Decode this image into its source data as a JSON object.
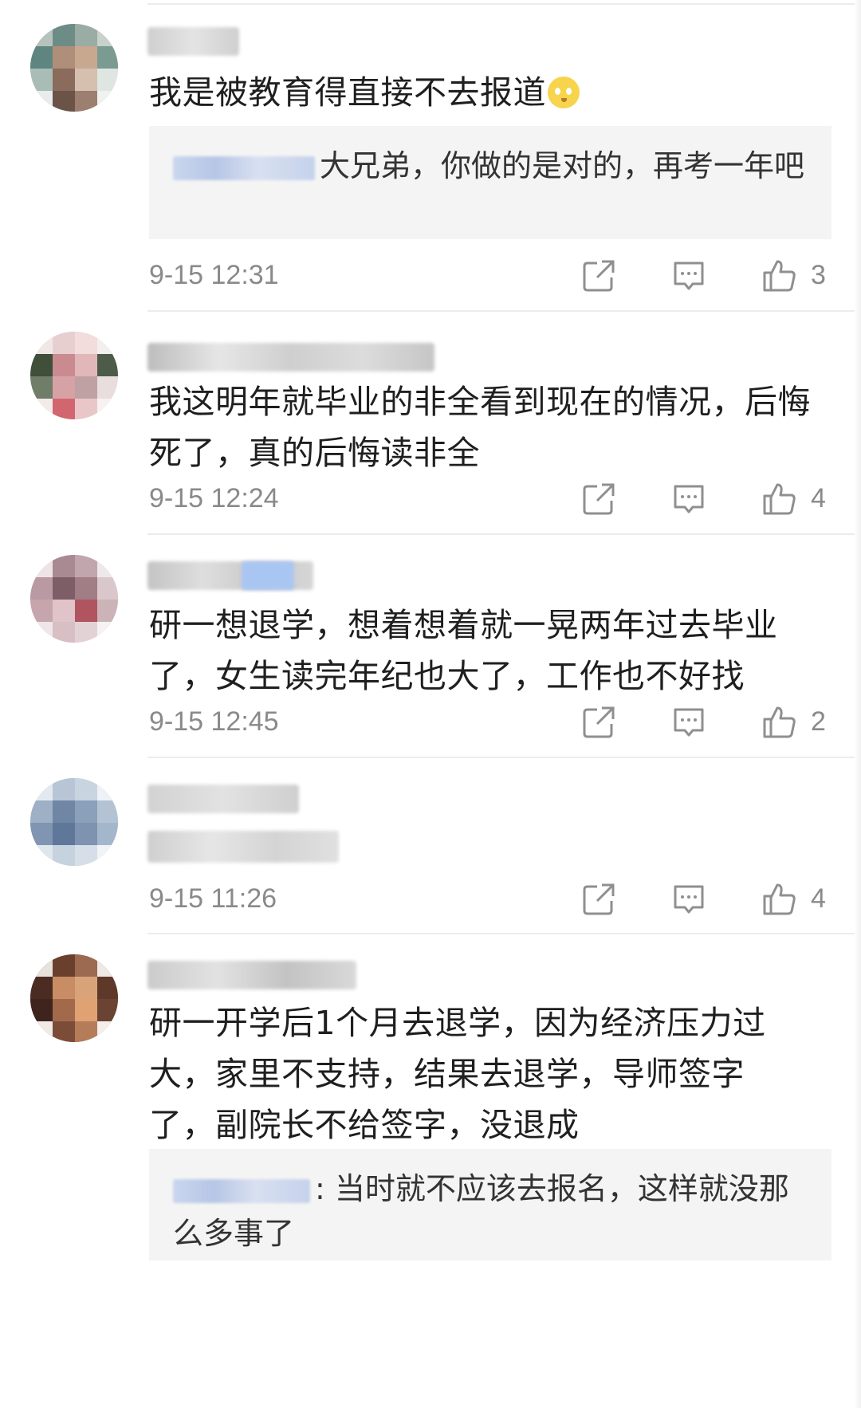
{
  "comments": [
    {
      "text": "我是被教育得直接不去报道",
      "emoji": "pleading-face",
      "reply": {
        "text": "大兄弟，你做的是对的，再考一年吧"
      },
      "time": "9-15 12:31",
      "likes": "3"
    },
    {
      "text": "我这明年就毕业的非全看到现在的情况，后悔死了，真的后悔读非全",
      "time": "9-15 12:24",
      "likes": "4"
    },
    {
      "text": "研一想退学，想着想着就一晃两年过去毕业了，女生读完年纪也大了，工作也不好找",
      "time": "9-15 12:45",
      "likes": "2"
    },
    {
      "text": "",
      "time": "9-15 11:26",
      "likes": "4"
    },
    {
      "text": "研一开学后1个月去退学，因为经济压力过大，家里不支持，结果去退学，导师签字了，副院长不给签字，没退成",
      "reply": {
        "text": ": 当时就不应该去报名，这样就没那么多事了"
      }
    }
  ],
  "icons": {
    "share": "share-icon",
    "reply": "comment-icon",
    "like": "thumbs-up-icon"
  },
  "colors": {
    "text": "#1f1f1f",
    "meta": "#8a8a8a",
    "reply_bg": "#f4f4f4",
    "divider": "#ececec"
  }
}
